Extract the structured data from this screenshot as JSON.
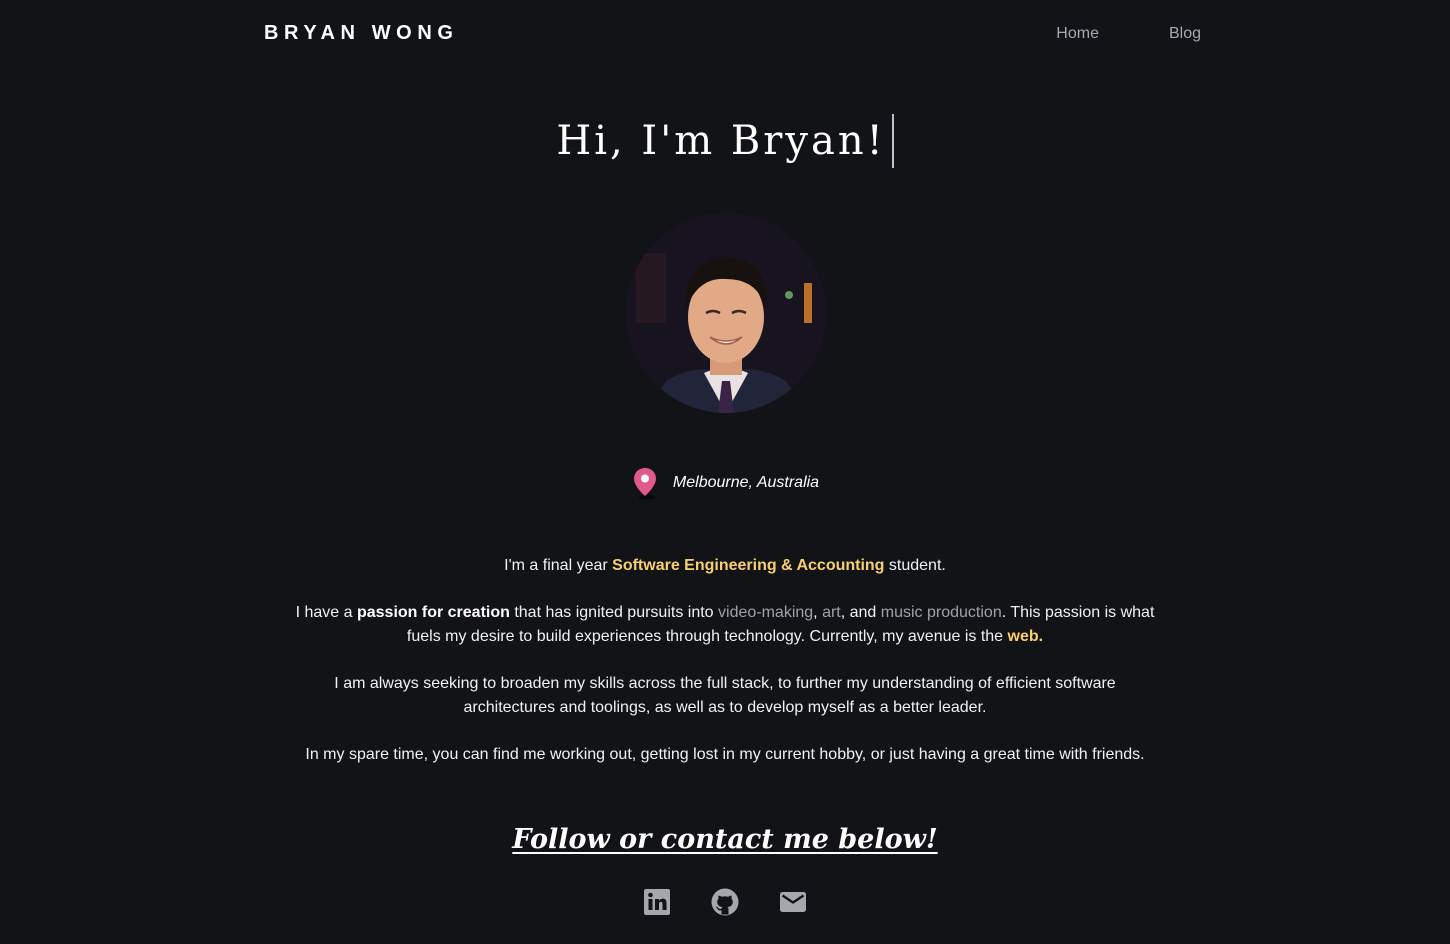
{
  "header": {
    "brand": "BRYAN WONG",
    "nav": [
      {
        "label": "Home"
      },
      {
        "label": "Blog"
      }
    ]
  },
  "hero": {
    "title": "Hi, I'm Bryan!"
  },
  "location": {
    "text": "Melbourne, Australia",
    "icon": "location-pin-icon",
    "icon_color": "#e05a8a"
  },
  "bio": {
    "p1": {
      "pre": "I'm a final year ",
      "highlight": "Software Engineering & Accounting",
      "post": " student."
    },
    "p2": {
      "pre": "I have a ",
      "strong": "passion for creation",
      "mid1": " that has ignited pursuits into ",
      "link1": "video-making",
      "sep1": ", ",
      "link2": "art",
      "sep2": ", and ",
      "link3": "music production",
      "mid2": ". This passion is what fuels my desire to build experiences through technology. Currently, my avenue is the ",
      "highlight": "web."
    },
    "p3": "I am always seeking to broaden my skills across the full stack, to further my understanding of efficient software architectures and toolings, as well as to develop myself as a better leader.",
    "p4": "In my spare time, you can find me working out, getting lost in my current hobby, or just having a great time with friends."
  },
  "follow": {
    "title": "Follow or contact me below!",
    "socials": [
      {
        "icon": "linkedin-icon"
      },
      {
        "icon": "github-icon"
      },
      {
        "icon": "email-icon"
      }
    ]
  },
  "colors": {
    "background": "#121317",
    "accent": "#f7cf6f",
    "link_muted": "#9ea1a8",
    "icon_grey": "#a5a7ad"
  }
}
